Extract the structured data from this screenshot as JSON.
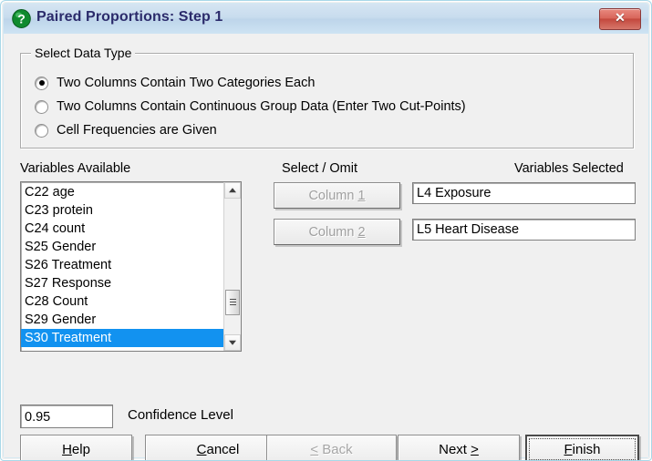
{
  "window": {
    "title": "Paired Proportions: Step 1",
    "icon": "question-mark-icon",
    "close_label": "✕",
    "accent_title_color": "#2b2b6b",
    "close_button_color": "#c3483d",
    "selection_color": "#1292f0",
    "background_color": "#f0f0f0"
  },
  "data_type_group": {
    "legend": "Select Data Type",
    "options": [
      {
        "label": "Two Columns Contain Two Categories Each",
        "checked": true
      },
      {
        "label": "Two Columns Contain Continuous Group Data (Enter Two Cut-Points)",
        "checked": false
      },
      {
        "label": "Cell Frequencies are Given",
        "checked": false
      }
    ]
  },
  "variables_available": {
    "header": "Variables Available",
    "items": [
      {
        "label": "C22 age",
        "selected": false
      },
      {
        "label": "C23 protein",
        "selected": false
      },
      {
        "label": "C24 count",
        "selected": false
      },
      {
        "label": "S25 Gender",
        "selected": false
      },
      {
        "label": "S26 Treatment",
        "selected": false
      },
      {
        "label": "S27 Response",
        "selected": false
      },
      {
        "label": "C28 Count",
        "selected": false
      },
      {
        "label": "S29 Gender",
        "selected": false
      },
      {
        "label": "S30 Treatment",
        "selected": true
      }
    ]
  },
  "select_omit": {
    "header": "Select / Omit",
    "buttons": [
      {
        "label_prefix": "Column ",
        "label_key": "1",
        "enabled": false
      },
      {
        "label_prefix": "Column ",
        "label_key": "2",
        "enabled": false
      }
    ]
  },
  "variables_selected": {
    "header": "Variables Selected",
    "fields": [
      {
        "value": "L4 Exposure"
      },
      {
        "value": "L5 Heart Disease"
      }
    ]
  },
  "confidence": {
    "value": "0.95",
    "label": "Confidence Level"
  },
  "footer": {
    "buttons": [
      {
        "pre": "",
        "accel": "H",
        "post": "elp",
        "enabled": true,
        "default": false
      },
      {
        "pre": "",
        "accel": "C",
        "post": "ancel",
        "enabled": true,
        "default": false
      },
      {
        "pre": "",
        "accel": "<",
        "post": " Back",
        "enabled": false,
        "default": false
      },
      {
        "pre": "Next ",
        "accel": ">",
        "post": "",
        "enabled": true,
        "default": false
      },
      {
        "pre": "",
        "accel": "F",
        "post": "inish",
        "enabled": true,
        "default": true
      }
    ]
  }
}
